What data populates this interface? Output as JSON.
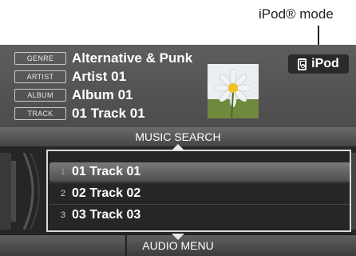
{
  "callout": {
    "ipod_mode": "iPod® mode"
  },
  "now_playing": {
    "genre_tag": "GENRE",
    "genre": "Alternative & Punk",
    "artist_tag": "ARTIST",
    "artist": "Artist 01",
    "album_tag": "ALBUM",
    "album": "Album 01",
    "track_tag": "TRACK",
    "track": "01 Track 01"
  },
  "source_badge": {
    "label": "iPod",
    "icon": "ipod-icon"
  },
  "music_search": {
    "label": "MUSIC SEARCH"
  },
  "track_list": [
    {
      "number": "1",
      "title": "01 Track 01",
      "selected": true
    },
    {
      "number": "2",
      "title": "02 Track 02",
      "selected": false
    },
    {
      "number": "3",
      "title": "03 Track 03",
      "selected": false
    }
  ],
  "audio_menu": {
    "label": "AUDIO MENU"
  },
  "colors": {
    "screen_bg": "#1c1c1c",
    "header_bg": "#555555",
    "text": "#ffffff"
  }
}
